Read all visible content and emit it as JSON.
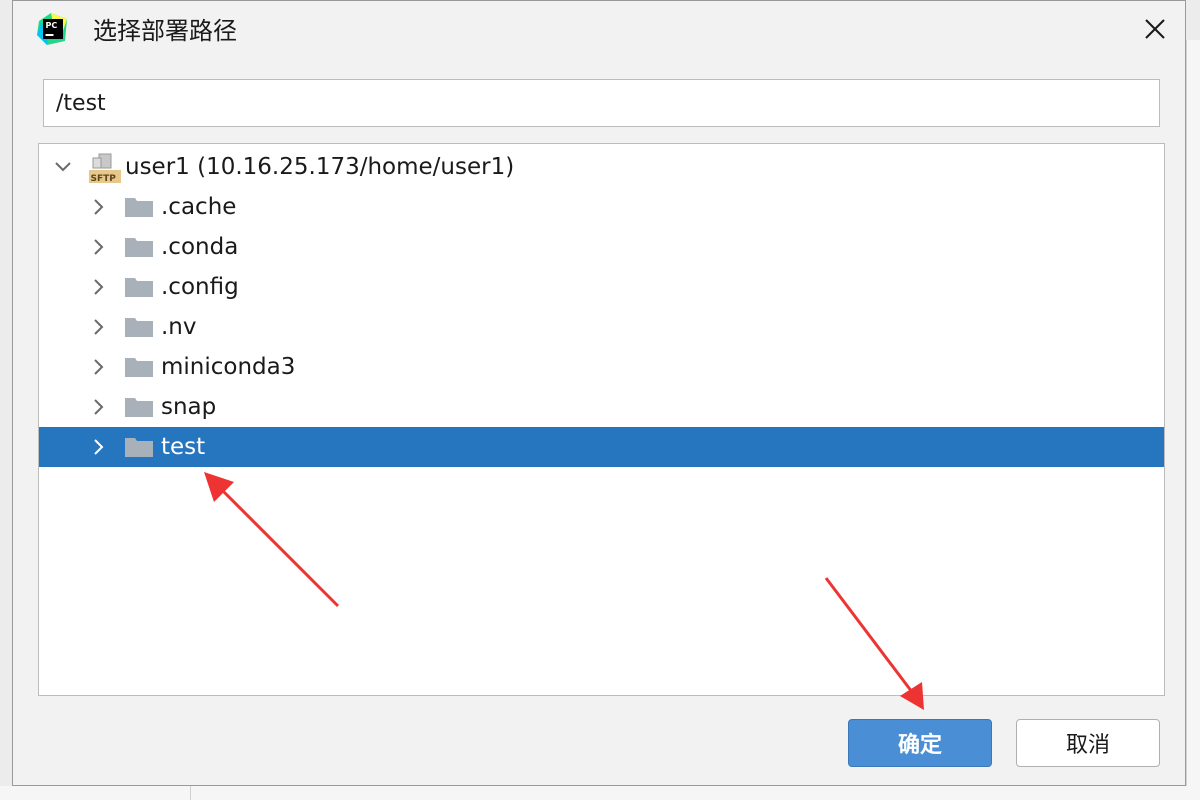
{
  "window": {
    "title": "选择部署路径",
    "app_icon": "pycharm-icon",
    "close_icon": "close-icon"
  },
  "path_input": {
    "value": "/test"
  },
  "tree": {
    "root": {
      "label": "user1 (10.16.25.173/home/user1)",
      "icon": "sftp-server-icon",
      "badge": "SFTP",
      "expanded": true
    },
    "items": [
      {
        "label": ".cache",
        "icon": "folder-icon",
        "selected": false
      },
      {
        "label": ".conda",
        "icon": "folder-icon",
        "selected": false
      },
      {
        "label": ".config",
        "icon": "folder-icon",
        "selected": false
      },
      {
        "label": ".nv",
        "icon": "folder-icon",
        "selected": false
      },
      {
        "label": "miniconda3",
        "icon": "folder-icon",
        "selected": false
      },
      {
        "label": "snap",
        "icon": "folder-icon",
        "selected": false
      },
      {
        "label": "test",
        "icon": "folder-icon",
        "selected": true
      }
    ]
  },
  "buttons": {
    "ok_label": "确定",
    "cancel_label": "取消"
  },
  "colors": {
    "selection": "#2675bf",
    "primary_button": "#4a8fd6",
    "annotation_arrow": "#ee3333",
    "folder": "#a8b1ba"
  }
}
